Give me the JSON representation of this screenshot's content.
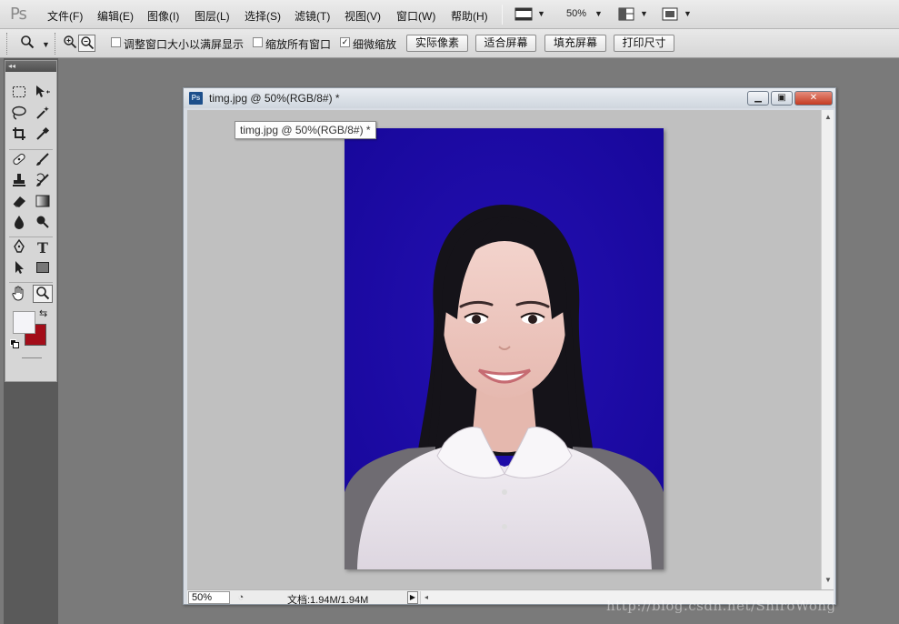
{
  "app": {
    "logo": "Ps"
  },
  "menu": [
    {
      "label": "文件(F)"
    },
    {
      "label": "编辑(E)"
    },
    {
      "label": "图像(I)"
    },
    {
      "label": "图层(L)"
    },
    {
      "label": "选择(S)"
    },
    {
      "label": "滤镜(T)"
    },
    {
      "label": "视图(V)"
    },
    {
      "label": "窗口(W)"
    },
    {
      "label": "帮助(H)"
    }
  ],
  "menubar_controls": {
    "zoom": "50%"
  },
  "options": {
    "resize_windows_label": "调整窗口大小以满屏显示",
    "resize_windows_checked": false,
    "zoom_all_label": "缩放所有窗口",
    "zoom_all_checked": false,
    "scrubby_label": "细微缩放",
    "scrubby_checked": true,
    "scrubby_mark": "✓",
    "actual_pixels": "实际像素",
    "fit_screen": "适合屏幕",
    "fill_screen": "填充屏幕",
    "print_size": "打印尺寸"
  },
  "toolbox": {
    "collapse_glyph": "◂◂",
    "foreground_color": "#f4f4f8",
    "background_color": "#a30d19"
  },
  "document": {
    "title": "timg.jpg @ 50%(RGB/8#) *",
    "ps_icon": "Ps",
    "tooltip": "timg.jpg @ 50%(RGB/8#) *",
    "background_color": "#1d0aa7"
  },
  "status": {
    "zoom": "50%",
    "doc_size": "文档:1.94M/1.94M"
  },
  "watermark": "http://blog.csdn.net/ShiroWong"
}
